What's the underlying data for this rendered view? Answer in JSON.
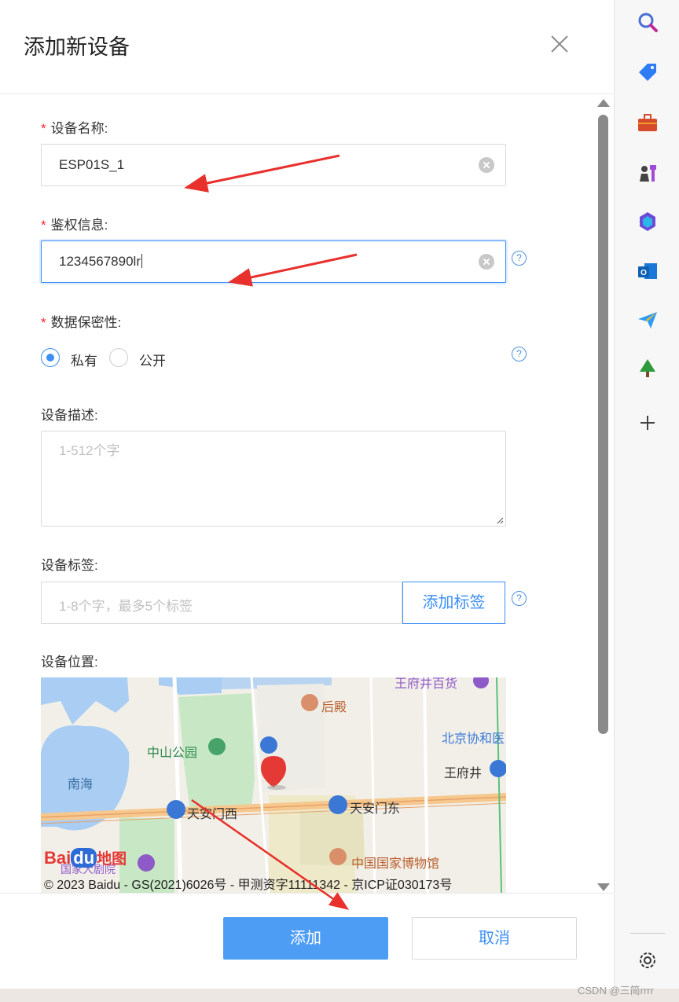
{
  "dialog": {
    "title": "添加新设备",
    "close_icon": "close-icon"
  },
  "form": {
    "device_name": {
      "label": "设备名称:",
      "required": "*",
      "value": "ESP01S_1"
    },
    "auth_info": {
      "label": "鉴权信息:",
      "required": "*",
      "value": "1234567890lr"
    },
    "privacy": {
      "label": "数据保密性:",
      "required": "*",
      "options": [
        "私有",
        "公开"
      ],
      "selected": "私有"
    },
    "description": {
      "label": "设备描述:",
      "placeholder": "1-512个字"
    },
    "tags": {
      "label": "设备标签:",
      "placeholder": "1-8个字，最多5个标签",
      "button": "添加标签"
    },
    "location": {
      "label": "设备位置:"
    },
    "help_glyph": "?"
  },
  "map": {
    "labels": {
      "wangfujing_mall": "王府井百货",
      "houdian": "后殿",
      "zhongshan_park": "中山公园",
      "beijing_union": "北京协和医",
      "wangfujing": "王府井",
      "nanhai": "南海",
      "tiananmen_west": "天安门西",
      "tiananmen_east": "天安门东",
      "national_museum": "中国国家博物馆",
      "theater": "国家大剧院"
    },
    "logo_text_bai": "Bai",
    "logo_text_du": "du",
    "logo_text_map": "地图",
    "copyright": "© 2023 Baidu - GS(2021)6026号 - 甲测资字11111342 - 京ICP证030173号"
  },
  "footer": {
    "submit": "添加",
    "cancel": "取消"
  },
  "sidebar": {
    "icons": [
      "search-icon",
      "tag-icon",
      "toolbox-icon",
      "games-icon",
      "copilot-icon",
      "outlook-icon",
      "send-icon",
      "tree-icon",
      "add-icon",
      "settings-icon"
    ]
  },
  "watermark": "CSDN @三简rrrr",
  "colors": {
    "accent": "#3b8ff5",
    "primary_button": "#4e9df5",
    "required": "#f5222d",
    "annotation_arrow": "#e8302c"
  }
}
